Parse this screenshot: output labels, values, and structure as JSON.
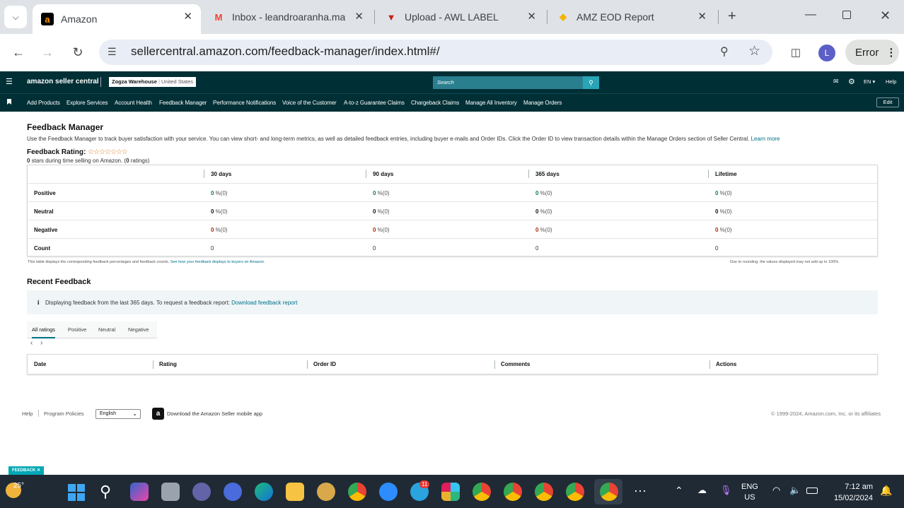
{
  "browser": {
    "tabs": [
      {
        "title": "Amazon",
        "favicon": "a",
        "color": "#ff9900"
      },
      {
        "title": "Inbox - leandroaranha.ma",
        "favicon": "M",
        "color": "#ea4335"
      },
      {
        "title": "Upload - AWL LABEL",
        "favicon": "▼",
        "color": "#c5221f"
      },
      {
        "title": "AMZ EOD Report",
        "favicon": "◆",
        "color": "#f4b400"
      }
    ],
    "url": "sellercentral.amazon.com/feedback-manager/index.html#/",
    "profile_letter": "L",
    "error_label": "Error"
  },
  "amazon": {
    "logo": "amazon seller central",
    "store": "Zogza Warehouse",
    "marketplace": "United States",
    "search_placeholder": "Search",
    "lang": "EN",
    "help": "Help",
    "edit": "Edit",
    "nav": [
      "Add Products",
      "Explore Services",
      "Account Health",
      "Feedback Manager",
      "Performance Notifications",
      "Voice of the Customer",
      "A-to-z Guarantee Claims",
      "Chargeback Claims",
      "Manage All Inventory",
      "Manage Orders"
    ]
  },
  "page": {
    "title": "Feedback Manager",
    "description": "Use the Feedback Manager to track buyer satisfaction with your service. You can view short- and long-term metrics, as well as detailed feedback entries, including buyer e-mails and Order IDs. Click the Order ID to view transaction details within the Manage Orders section of Seller Central.",
    "learn_more": "Learn more",
    "rating_label": "Feedback Rating:",
    "rating_stars": 0,
    "stars_count": "0",
    "stars_text_a": " stars during time selling on Amazon. (",
    "ratings_count": "0",
    "stars_text_b": " ratings)",
    "table": {
      "columns": [
        "30 days",
        "90 days",
        "365 days",
        "Lifetime"
      ],
      "rows": [
        {
          "label": "Positive",
          "values": [
            "0",
            "0",
            "0",
            "0"
          ],
          "unit": " %(0)",
          "tone": "g"
        },
        {
          "label": "Neutral",
          "values": [
            "0",
            "0",
            "0",
            "0"
          ],
          "unit": " %(0)",
          "tone": "n"
        },
        {
          "label": "Negative",
          "values": [
            "0",
            "0",
            "0",
            "0"
          ],
          "unit": " %(0)",
          "tone": "r"
        },
        {
          "label": "Count",
          "values": [
            "0",
            "0",
            "0",
            "0"
          ],
          "unit": "",
          "tone": "c"
        }
      ]
    },
    "table_note_a": "This table displays the corresponding feedback percentages and feedback counts.",
    "table_note_link": "See how your feedback displays to buyers on Amazon.",
    "rounding_note": "Due to rounding, the values displayed may not add up to 100%.",
    "recent_title": "Recent Feedback",
    "info_text": "Displaying feedback from the last 365 days. To request a feedback report:",
    "info_link": "Download feedback report",
    "filter_tabs": [
      "All ratings",
      "Positive",
      "Neutral",
      "Negative"
    ],
    "feedback_columns": [
      "Date",
      "Rating",
      "Order ID",
      "Comments",
      "Actions"
    ]
  },
  "footer": {
    "help": "Help",
    "program_policies": "Program Policies",
    "language": "English",
    "download_app": "Download the Amazon Seller mobile app",
    "copyright": "© 1999-2024, Amazon.com, Inc. or its affiliates",
    "feedback_badge": "FEEDBACK"
  },
  "taskbar": {
    "weather": "25°",
    "lang_top": "ENG",
    "lang_bottom": "US",
    "time": "7:12 am",
    "date": "15/02/2024",
    "telegram_badge": "11"
  }
}
